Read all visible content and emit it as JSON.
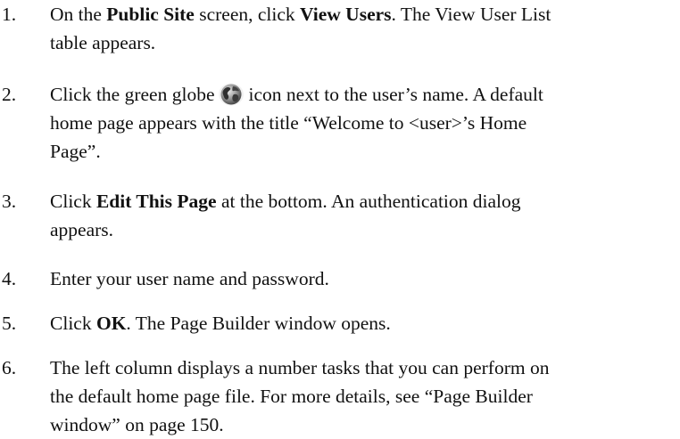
{
  "steps": [
    {
      "number": "1.",
      "pre1": "On the ",
      "bold1": "Public Site",
      "mid1": " screen, click ",
      "bold2": "View Users",
      "post1": ". The View User List",
      "line2": "table appears."
    },
    {
      "number": "2.",
      "pre": "Click the green globe",
      "post": "icon next to the user’s name. A default",
      "line2": "home page appears with the title “Welcome to <user>’s Home",
      "line3": "Page”.",
      "icon": "green-globe-icon"
    },
    {
      "number": "3.",
      "pre": "Click ",
      "bold": "Edit This Page",
      "post": " at the bottom. An authentication dialog",
      "line2": "appears."
    },
    {
      "number": "4.",
      "text": "Enter your user name and password."
    },
    {
      "number": "5.",
      "pre": "Click ",
      "bold": "OK",
      "post": ". The Page Builder window opens."
    },
    {
      "number": "6.",
      "line1": "The left column displays a number tasks that you can perform on",
      "line2": "the default home page file. For more details, see “Page Builder",
      "line3": "window” on page 150."
    }
  ],
  "colors": {
    "text": "#111111",
    "globe_green": "#3d8a2a",
    "globe_dark": "#333333"
  }
}
